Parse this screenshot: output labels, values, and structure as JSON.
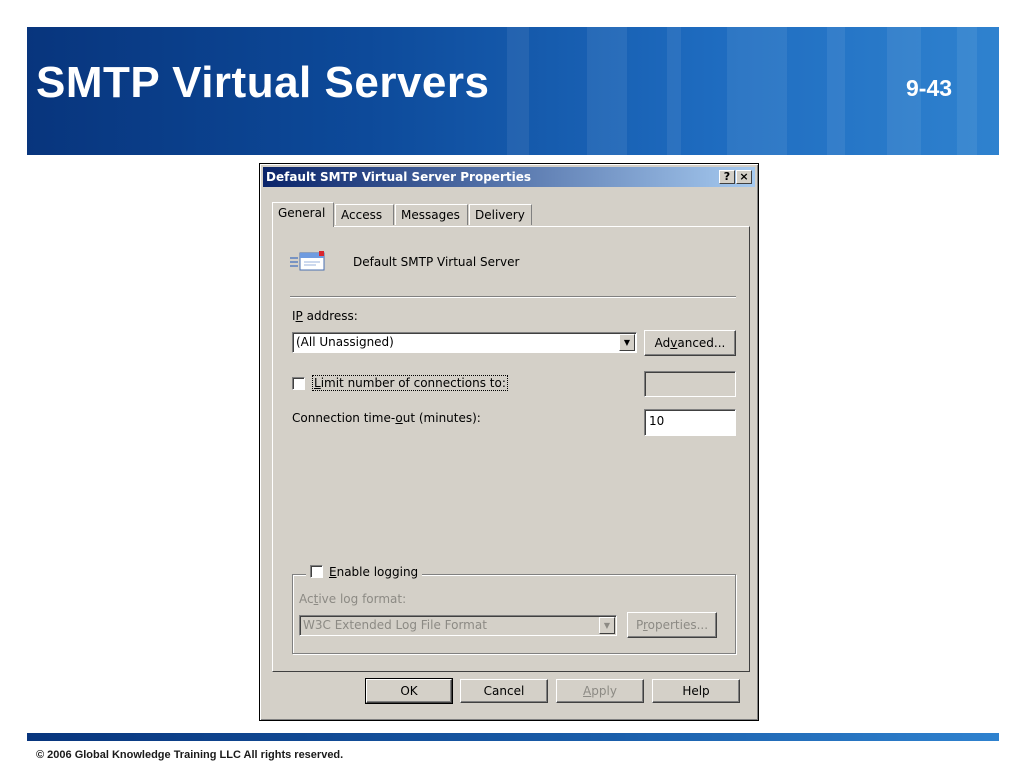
{
  "slide": {
    "title": "SMTP Virtual Servers",
    "number": "9-43",
    "copyright": "© 2006 Global Knowledge Training LLC All rights reserved."
  },
  "dialog": {
    "title": "Default SMTP Virtual Server Properties",
    "help_button": "?",
    "close_button": "×",
    "tabs": [
      "General",
      "Access",
      "Messages",
      "Delivery"
    ],
    "active_tab": "General",
    "server_name": "Default SMTP Virtual Server",
    "ip_address": {
      "label_pre": "I",
      "label_accel": "P",
      "label_post": " address:",
      "value": "(All Unassigned)"
    },
    "advanced_button": {
      "pre": "Ad",
      "accel": "v",
      "post": "anced..."
    },
    "limit_connections": {
      "pre": "",
      "accel": "L",
      "post": "imit number of connections to:",
      "checked": false,
      "value": ""
    },
    "timeout": {
      "pre": "Connection time-",
      "accel": "o",
      "post": "ut (minutes):",
      "value": "10"
    },
    "logging": {
      "pre": "",
      "accel": "E",
      "post": "nable logging",
      "checked": false,
      "format_label_pre": "Ac",
      "format_label_accel": "t",
      "format_label_post": "ive log format:",
      "format_value": "W3C Extended Log File Format",
      "properties_pre": "P",
      "properties_accel": "r",
      "properties_post": "operties..."
    },
    "buttons": {
      "ok": "OK",
      "cancel": "Cancel",
      "apply_accel": "A",
      "apply_post": "pply",
      "help": "Help"
    }
  },
  "colors": {
    "banner_dark": "#08357d",
    "banner_light": "#2f82cf",
    "dialog_face": "#d4d0c8",
    "titlebar_start": "#0a246a",
    "titlebar_end": "#a6caf0"
  }
}
